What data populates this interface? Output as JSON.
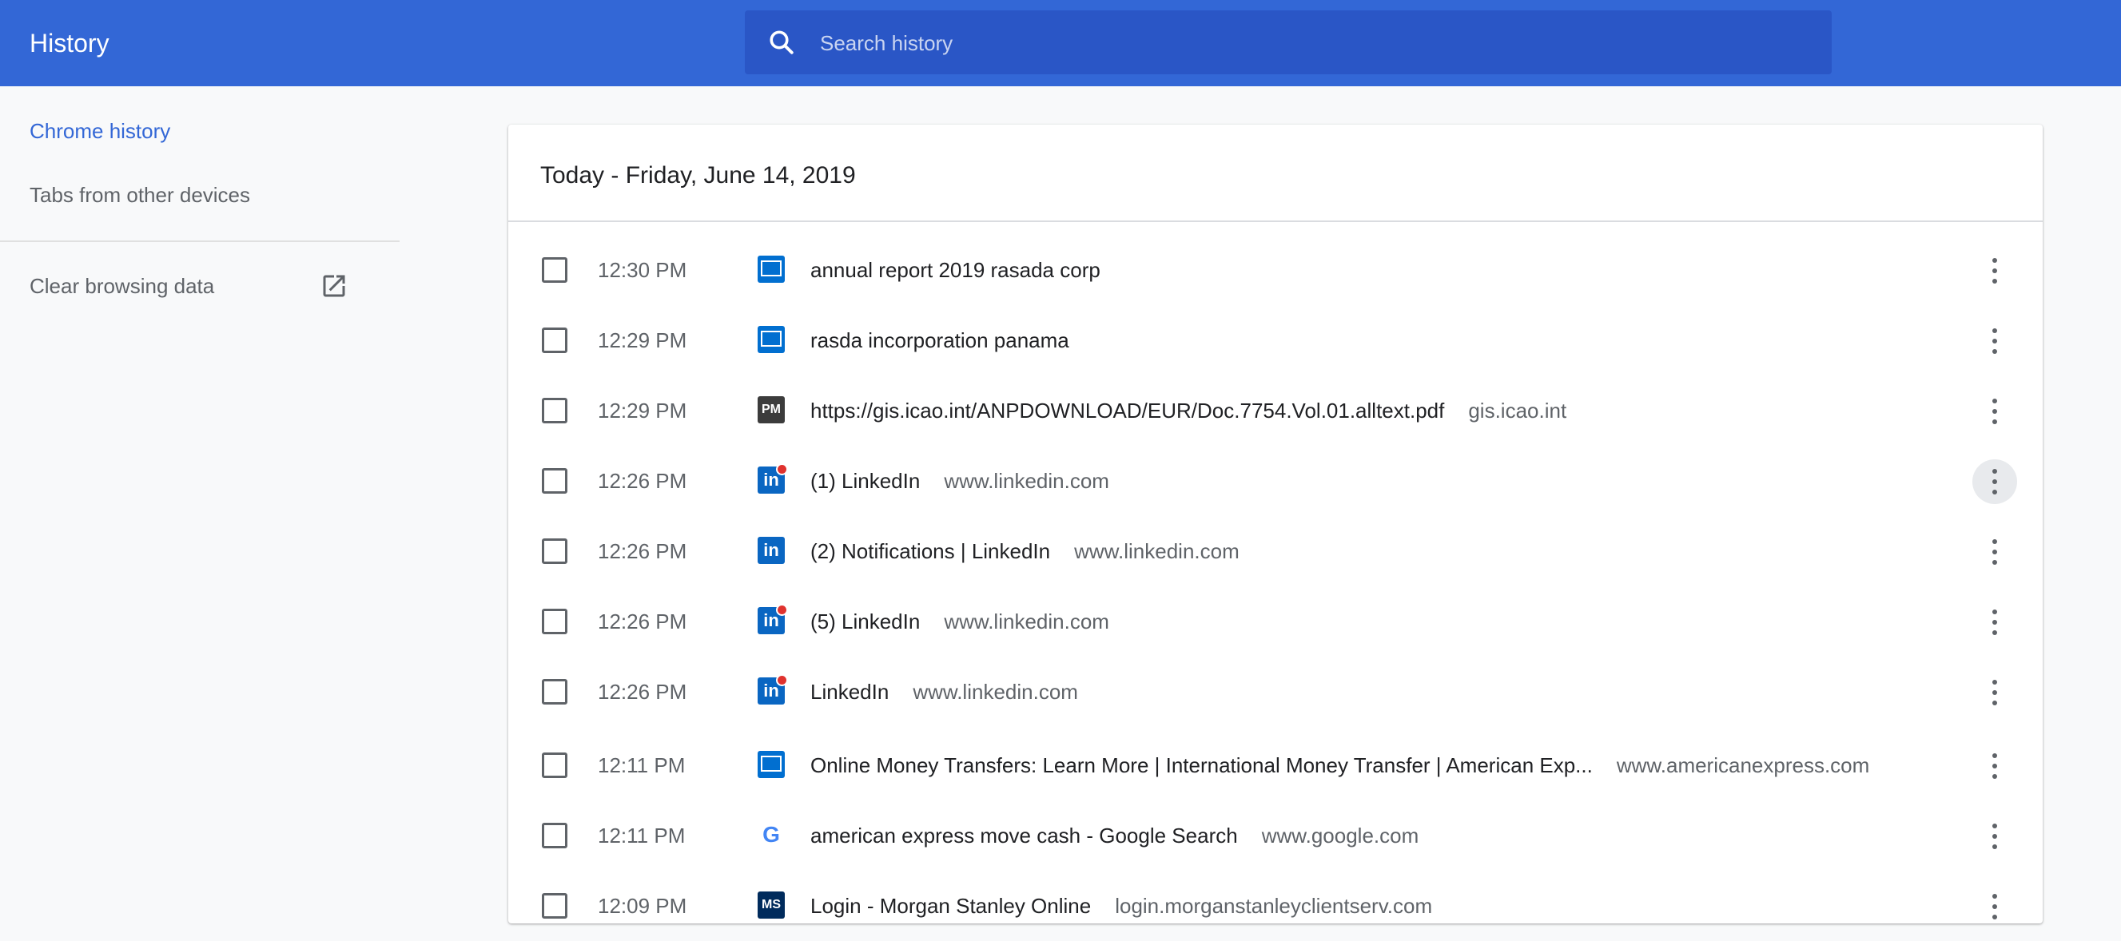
{
  "header": {
    "title": "History",
    "search_placeholder": "Search history"
  },
  "sidebar": {
    "items": [
      {
        "label": "Chrome history",
        "active": true
      },
      {
        "label": "Tabs from other devices",
        "active": false
      }
    ],
    "clear_label": "Clear browsing data"
  },
  "history": {
    "date_heading": "Today - Friday, June 14, 2019",
    "rows": [
      {
        "time": "12:30 PM",
        "icon": "amex-favicon",
        "title": "annual report 2019 rasada corp",
        "domain": ""
      },
      {
        "time": "12:29 PM",
        "icon": "amex-favicon",
        "title": "rasda incorporation panama",
        "domain": ""
      },
      {
        "time": "12:29 PM",
        "icon": "pm-favicon",
        "title": "https://gis.icao.int/ANPDOWNLOAD/EUR/Doc.7754.Vol.01.alltext.pdf",
        "domain": "gis.icao.int"
      },
      {
        "time": "12:26 PM",
        "icon": "linkedin-favicon",
        "title": "(1) LinkedIn",
        "domain": "www.linkedin.com"
      },
      {
        "time": "12:26 PM",
        "icon": "linkedin-favicon",
        "title": "(2) Notifications | LinkedIn",
        "domain": "www.linkedin.com"
      },
      {
        "time": "12:26 PM",
        "icon": "linkedin-favicon",
        "title": "(5) LinkedIn",
        "domain": "www.linkedin.com"
      },
      {
        "time": "12:26 PM",
        "icon": "linkedin-favicon",
        "title": "LinkedIn",
        "domain": "www.linkedin.com"
      },
      {
        "time": "12:11 PM",
        "icon": "amex-favicon",
        "title": "Online Money Transfers: Learn More | International Money Transfer | American Exp...",
        "domain": "www.americanexpress.com"
      },
      {
        "time": "12:11 PM",
        "icon": "google-favicon",
        "title": "american express move cash - Google Search",
        "domain": "www.google.com"
      },
      {
        "time": "12:09 PM",
        "icon": "morgan-stanley-favicon",
        "title": "Login - Morgan Stanley Online",
        "domain": "login.morganstanleyclientserv.com"
      }
    ]
  },
  "colors": {
    "header_bg": "#3367d6",
    "search_bg": "#2a56c6",
    "active_link": "#3367d6"
  }
}
